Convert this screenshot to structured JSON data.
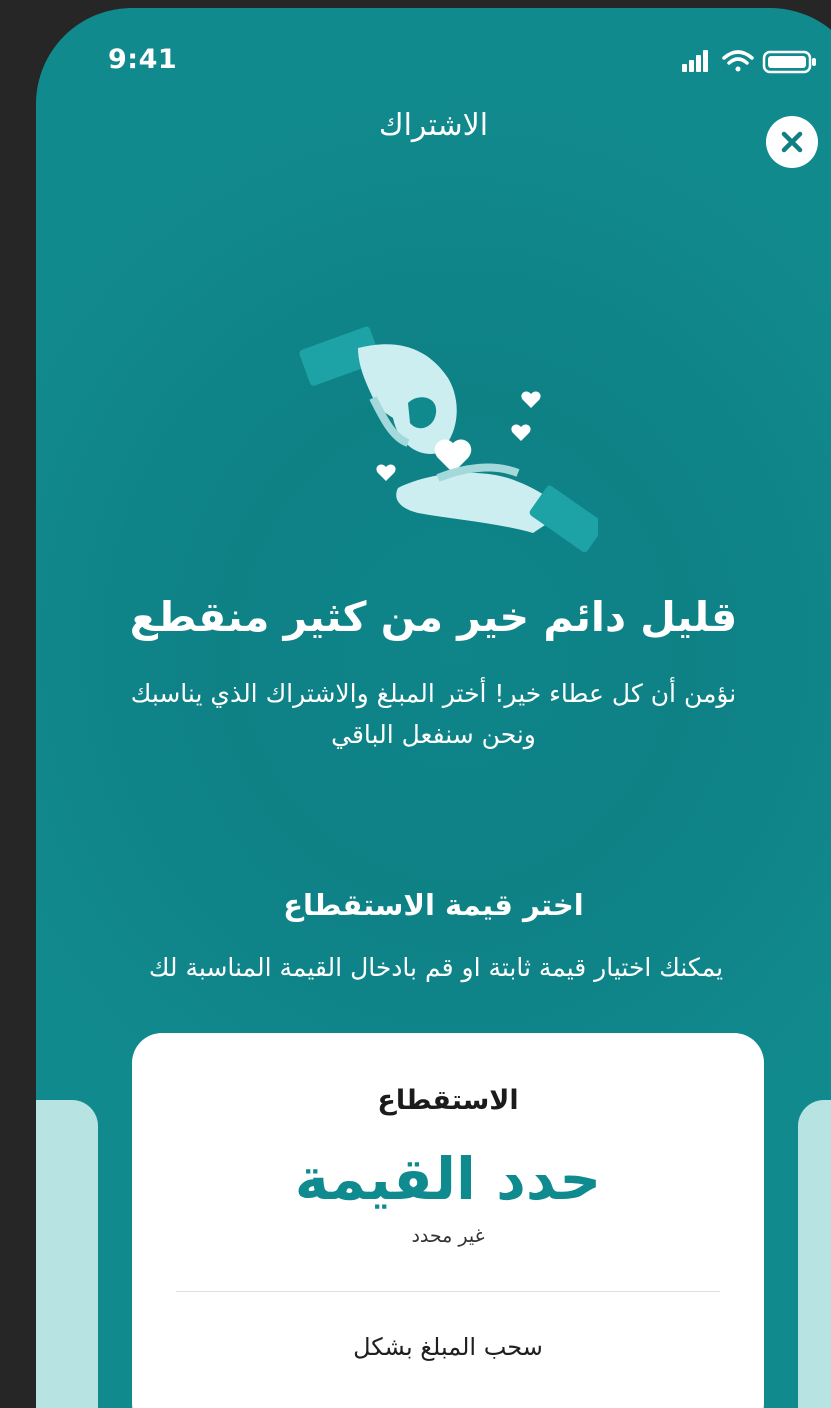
{
  "status_bar": {
    "time": "9:41"
  },
  "header": {
    "title": "الاشتراك"
  },
  "hero": {
    "headline": "قليل دائم خير من كثير منقطع",
    "description_line1": "نؤمن أن كل عطاء خير! أختر المبلغ والاشتراك الذي يناسبك",
    "description_line2": "ونحن سنفعل الباقي"
  },
  "deduction_section": {
    "title": "اختر قيمة الاستقطاع",
    "subtitle": "يمكنك اختيار قيمة ثابتة او قم بادخال القيمة المناسبة لك"
  },
  "amount_card": {
    "label": "الاستقطاع",
    "value": "حدد القيمة",
    "hint": "غير محدد",
    "footer": "سحب المبلغ بشكل"
  },
  "colors": {
    "primary": "#0e8185",
    "accent_text": "#0f8a8e",
    "side_card": "#b7e3e3",
    "background": "#262626"
  },
  "icons": [
    "signal-icon",
    "wifi-icon",
    "battery-icon",
    "close-icon",
    "giving-hands-illustration"
  ]
}
